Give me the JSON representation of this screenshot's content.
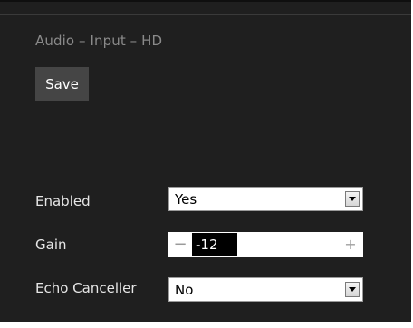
{
  "panel": {
    "title": "Audio – Input – HD",
    "save_label": "Save"
  },
  "fields": {
    "enabled": {
      "label": "Enabled",
      "value": "Yes"
    },
    "gain": {
      "label": "Gain",
      "value": "-12",
      "decrement": "−",
      "increment": "+"
    },
    "echo_canceller": {
      "label": "Echo Canceller",
      "value": "No"
    }
  },
  "icons": {
    "dropdown": "chevron-down-icon",
    "decrement": "minus-icon",
    "increment": "plus-icon"
  },
  "colors": {
    "panel_background": "#1f1f1f",
    "title_text": "#8a8a8a",
    "label_text": "#e6e6e6",
    "button_background": "#454545",
    "value_highlight": "#000000"
  }
}
